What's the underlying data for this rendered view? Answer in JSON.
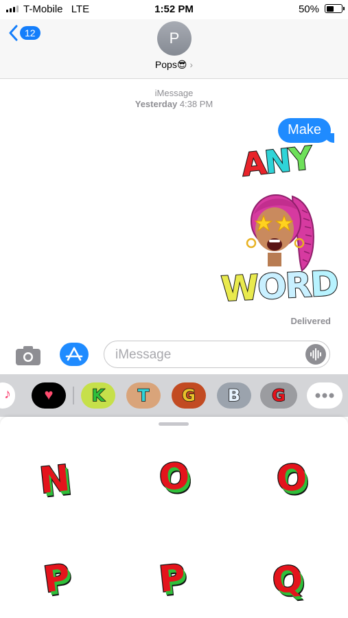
{
  "status_bar": {
    "carrier": "T-Mobile",
    "network": "LTE",
    "time": "1:52 PM",
    "battery_percent": "50%",
    "battery_level": 0.5
  },
  "header": {
    "back_count": "12",
    "avatar_initial": "P",
    "contact_name": "Pops😎"
  },
  "thread": {
    "service": "iMessage",
    "day": "Yesterday",
    "time": "4:38 PM",
    "message_text": "Make",
    "sticker_top_text": "ANY",
    "sticker_bottom_text": "WORD",
    "delivery_status": "Delivered"
  },
  "composer": {
    "placeholder": "iMessage"
  },
  "app_strip": {
    "items": [
      {
        "name": "music-app-icon"
      },
      {
        "name": "heart-app-icon"
      },
      {
        "name": "sticker-pack-k",
        "letter": "K"
      },
      {
        "name": "sticker-pack-t",
        "letter": "T"
      },
      {
        "name": "sticker-pack-g",
        "letter": "G"
      },
      {
        "name": "sticker-pack-b",
        "letter": "B"
      },
      {
        "name": "sticker-pack-red",
        "letter": "G",
        "selected": true
      },
      {
        "name": "more-apps-icon"
      }
    ]
  },
  "sticker_grid": [
    "N",
    "O",
    "O",
    "P",
    "P",
    "Q"
  ],
  "colors": {
    "accent": "#1f8bff",
    "sticker_red": "#e4141c",
    "sticker_green": "#2fbf3a",
    "graffiti_cyan": "#2fd4d8"
  }
}
